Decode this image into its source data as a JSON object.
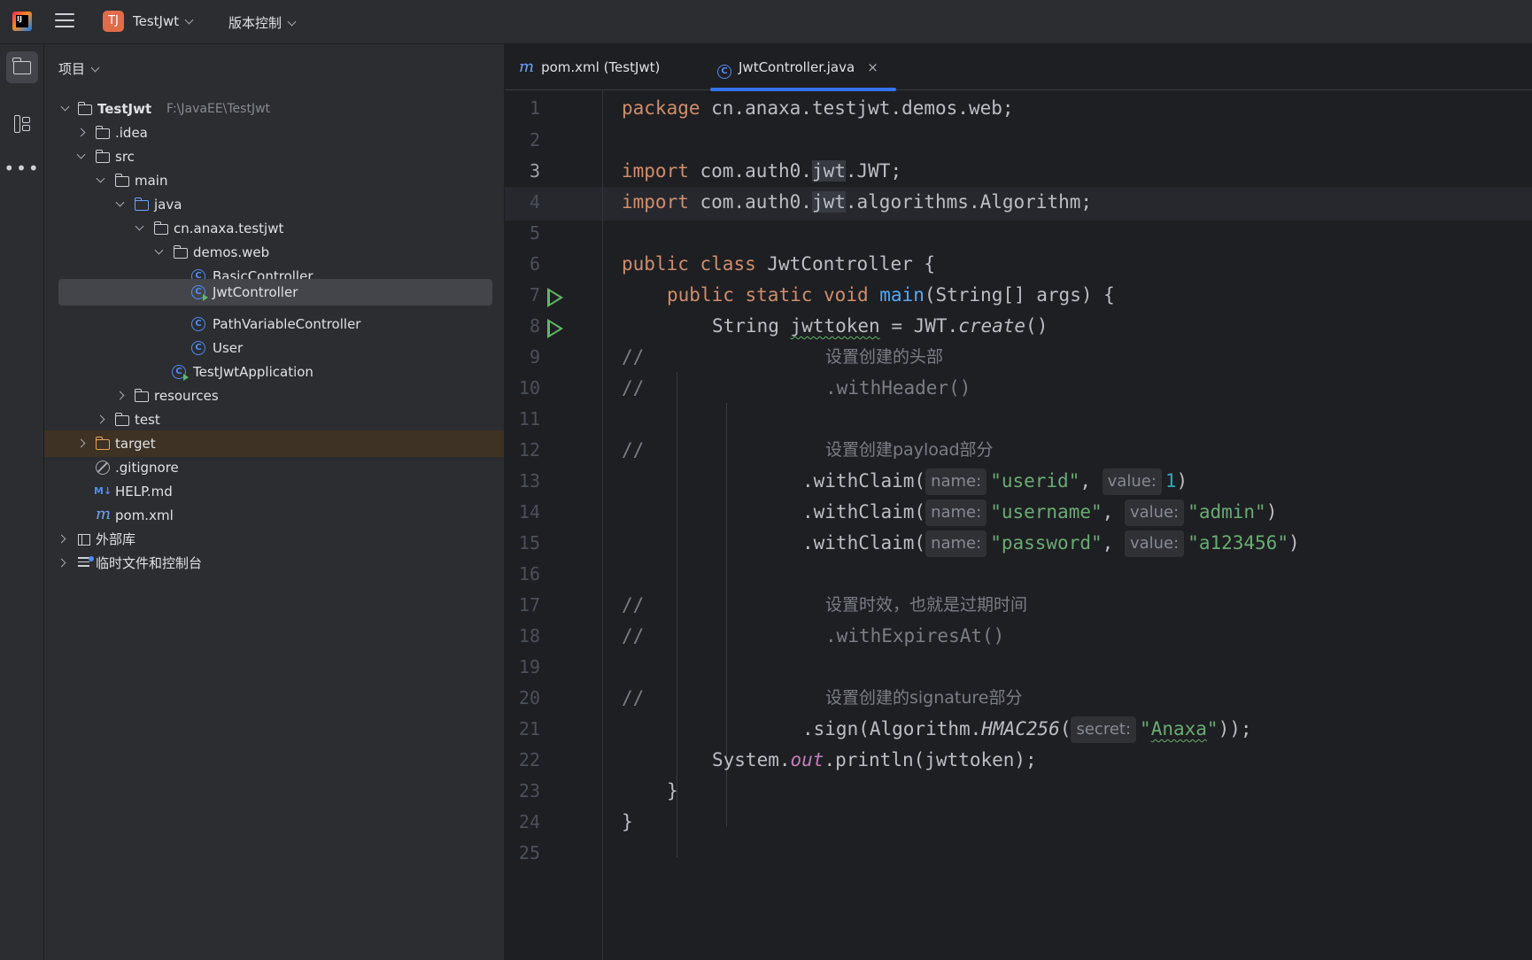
{
  "titlebar": {
    "logo_text": "IJ",
    "project_badge": "TJ",
    "project_name": "TestJwt",
    "vcs_menu": "版本控制"
  },
  "sidebar_tools": [
    "project-icon",
    "structure-icon",
    "more-icon"
  ],
  "project_panel": {
    "title": "项目",
    "tree": [
      {
        "label": "TestJwt",
        "path": "F:\\JavaEE\\TestJwt",
        "icon": "module-folder-icon",
        "expanded": true
      },
      {
        "label": ".idea",
        "icon": "folder-icon"
      },
      {
        "label": "src",
        "icon": "folder-icon",
        "expanded": true
      },
      {
        "label": "main",
        "icon": "folder-icon",
        "expanded": true
      },
      {
        "label": "java",
        "icon": "source-folder-icon",
        "expanded": true
      },
      {
        "label": "cn.anaxa.testjwt",
        "icon": "package-icon",
        "expanded": true
      },
      {
        "label": "demos.web",
        "icon": "package-icon",
        "expanded": true
      },
      {
        "label": "BasicController",
        "icon": "class-icon"
      },
      {
        "label": "JwtController",
        "icon": "class-run-icon",
        "selected": true
      },
      {
        "label": "PathVariableController",
        "icon": "class-icon"
      },
      {
        "label": "User",
        "icon": "class-icon"
      },
      {
        "label": "TestJwtApplication",
        "icon": "class-run-icon"
      },
      {
        "label": "resources",
        "icon": "resources-folder-icon"
      },
      {
        "label": "test",
        "icon": "folder-icon"
      },
      {
        "label": "target",
        "icon": "excluded-folder-icon"
      },
      {
        "label": ".gitignore",
        "icon": "ignore-file-icon"
      },
      {
        "label": "HELP.md",
        "icon": "markdown-icon",
        "icon_text": "M↓"
      },
      {
        "label": "pom.xml",
        "icon": "maven-icon",
        "icon_text": "m"
      },
      {
        "label": "外部库",
        "icon": "library-icon"
      },
      {
        "label": "临时文件和控制台",
        "icon": "scratch-icon"
      }
    ]
  },
  "editor": {
    "tabs": [
      {
        "label": "pom.xml (TestJwt)",
        "icon_text": "m",
        "active": false
      },
      {
        "label": "JwtController.java",
        "icon_text": "C",
        "active": true,
        "close": "×"
      }
    ],
    "line_numbers": [
      "1",
      "2",
      "3",
      "4",
      "5",
      "6",
      "7",
      "8",
      "9",
      "10",
      "11",
      "12",
      "13",
      "14",
      "15",
      "16",
      "17",
      "18",
      "19",
      "20",
      "21",
      "22",
      "23",
      "24",
      "25"
    ],
    "current_line": 3,
    "code": {
      "l1_kw": "package",
      "l1_rest": " cn.anaxa.testjwt.demos.web;",
      "l3_kw": "import",
      "l3_a": " com.auth0.",
      "l3_hl": "jwt",
      "l3_b": ".JWT;",
      "l4_kw": "import",
      "l4_a": " com.auth0.",
      "l4_hl": "jwt",
      "l4_b": ".algorithms.Algorithm;",
      "l6_kw1": "public",
      "l6_kw2": "class",
      "l6_rest": " JwtController {",
      "l7_kw1": "public",
      "l7_kw2": "static",
      "l7_kw3": "void",
      "l7_fn": "main",
      "l7_rest": "(String[] args) {",
      "l8_a": "String ",
      "l8_var": "jwttoken",
      "l8_b": " = JWT.",
      "l8_it": "create",
      "l8_c": "()",
      "l9_cm": "//",
      "l9_cn": "设置创建的头部",
      "l10_cm": "//",
      "l10_rest": ".withHeader()",
      "l12_cm": "//",
      "l12_cn": "设置创建payload部分",
      "l13_a": ".withClaim(",
      "l13_h1": "name:",
      "l13_s1": "\"userid\"",
      "l13_sep": ", ",
      "l13_h2": "value:",
      "l13_n": "1",
      "l13_end": ")",
      "l14_a": ".withClaim(",
      "l14_h1": "name:",
      "l14_s1": "\"username\"",
      "l14_sep": ", ",
      "l14_h2": "value:",
      "l14_s2": "\"admin\"",
      "l14_end": ")",
      "l15_a": ".withClaim(",
      "l15_h1": "name:",
      "l15_s1": "\"password\"",
      "l15_sep": ", ",
      "l15_h2": "value:",
      "l15_s2": "\"a123456\"",
      "l15_end": ")",
      "l17_cm": "//",
      "l17_cn": "设置时效，也就是过期时间",
      "l18_cm": "//",
      "l18_rest": ".withExpiresAt()",
      "l20_cm": "//",
      "l20_cn": "设置创建的signature部分",
      "l21_a": ".sign(Algorithm.",
      "l21_it": "HMAC256",
      "l21_b": "(",
      "l21_h": "secret:",
      "l21_q1": "\"",
      "l21_s": "Anaxa",
      "l21_q2": "\"",
      "l21_end": "));",
      "l22_a": "System.",
      "l22_out": "out",
      "l22_b": ".println(jwttoken);",
      "l23": "}",
      "l24": "}"
    }
  },
  "colors": {
    "background": "#1e1f22",
    "panel": "#2b2d30",
    "keyword": "#cf8e6d",
    "string": "#6aab73",
    "function": "#56a8f5",
    "number": "#2aacb8",
    "comment": "#7a7e85",
    "accent": "#3574f0",
    "run_green": "#5fb865"
  }
}
